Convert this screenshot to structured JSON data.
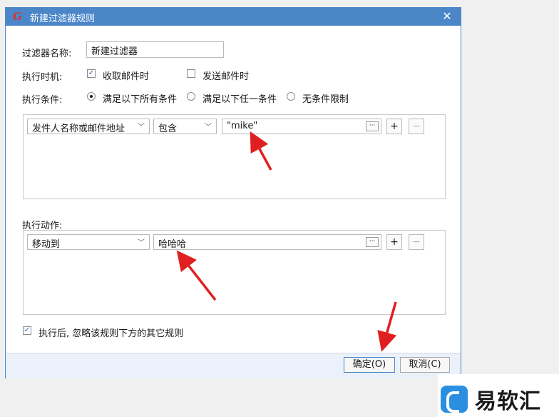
{
  "window": {
    "title": "新建过滤器规则",
    "close_glyph": "✕",
    "app_icon": "G"
  },
  "name_field": {
    "label": "过滤器名称:",
    "value": "新建过滤器"
  },
  "timing": {
    "label": "执行时机:",
    "receive": {
      "label": "收取邮件时",
      "checked": true
    },
    "send": {
      "label": "发送邮件时",
      "checked": false
    }
  },
  "condition": {
    "label": "执行条件:",
    "options": [
      "满足以下所有条件",
      "满足以下任一条件",
      "无条件限制"
    ],
    "selected": 0
  },
  "condition_row": {
    "field": "发件人名称或邮件地址",
    "operator": "包含",
    "value": "\"mike\""
  },
  "actions": {
    "label": "执行动作:",
    "row": {
      "action": "移动到",
      "target": "哈哈哈"
    }
  },
  "stop_rule": {
    "label": "执行后, 忽略该规则下方的其它规则",
    "checked": true
  },
  "buttons": {
    "ok": "确定(O)",
    "cancel": "取消(C)",
    "add": "+",
    "remove": "−",
    "browse": "···"
  },
  "watermark": {
    "text": "易软汇"
  },
  "colors": {
    "titlebar": "#4a86c8",
    "footer": "#eaf1fa",
    "arrow": "#e02020"
  }
}
